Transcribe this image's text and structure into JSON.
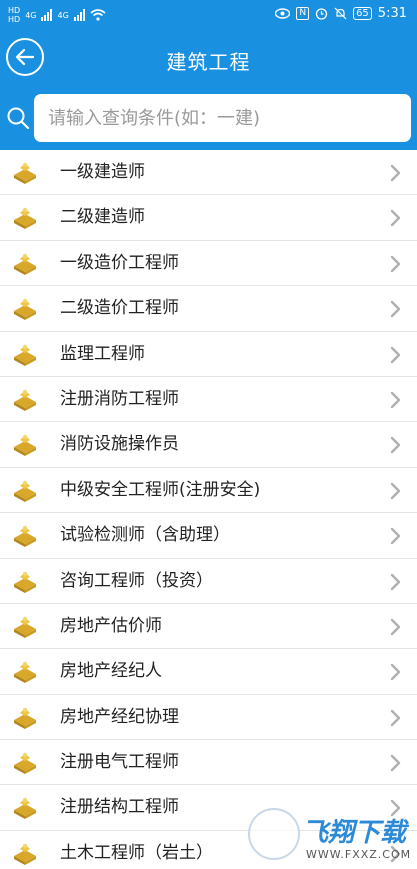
{
  "status_bar": {
    "hd1": "HD",
    "hd2": "HD",
    "net1": "4G",
    "net2": "4G",
    "nfc": "N",
    "battery": "65",
    "time": "5:31"
  },
  "header": {
    "title": "建筑工程"
  },
  "search": {
    "placeholder": "请输入查询条件(如：一建)"
  },
  "list": {
    "items": [
      {
        "label": "一级建造师"
      },
      {
        "label": "二级建造师"
      },
      {
        "label": "一级造价工程师"
      },
      {
        "label": "二级造价工程师"
      },
      {
        "label": "监理工程师"
      },
      {
        "label": "注册消防工程师"
      },
      {
        "label": "消防设施操作员"
      },
      {
        "label": "中级安全工程师(注册安全)"
      },
      {
        "label": "试验检测师（含助理）"
      },
      {
        "label": "咨询工程师（投资）"
      },
      {
        "label": "房地产估价师"
      },
      {
        "label": "房地产经纪人"
      },
      {
        "label": "房地产经纪协理"
      },
      {
        "label": "注册电气工程师"
      },
      {
        "label": "注册结构工程师"
      },
      {
        "label": "土木工程师（岩土）"
      }
    ]
  },
  "watermark": {
    "text": "飞翔下载",
    "url": "WWW.FXXZ.COM"
  },
  "colors": {
    "header_bg": "#1a90e0",
    "bullet_gold": "#d9a82a",
    "chevron": "#b0b0b0"
  }
}
